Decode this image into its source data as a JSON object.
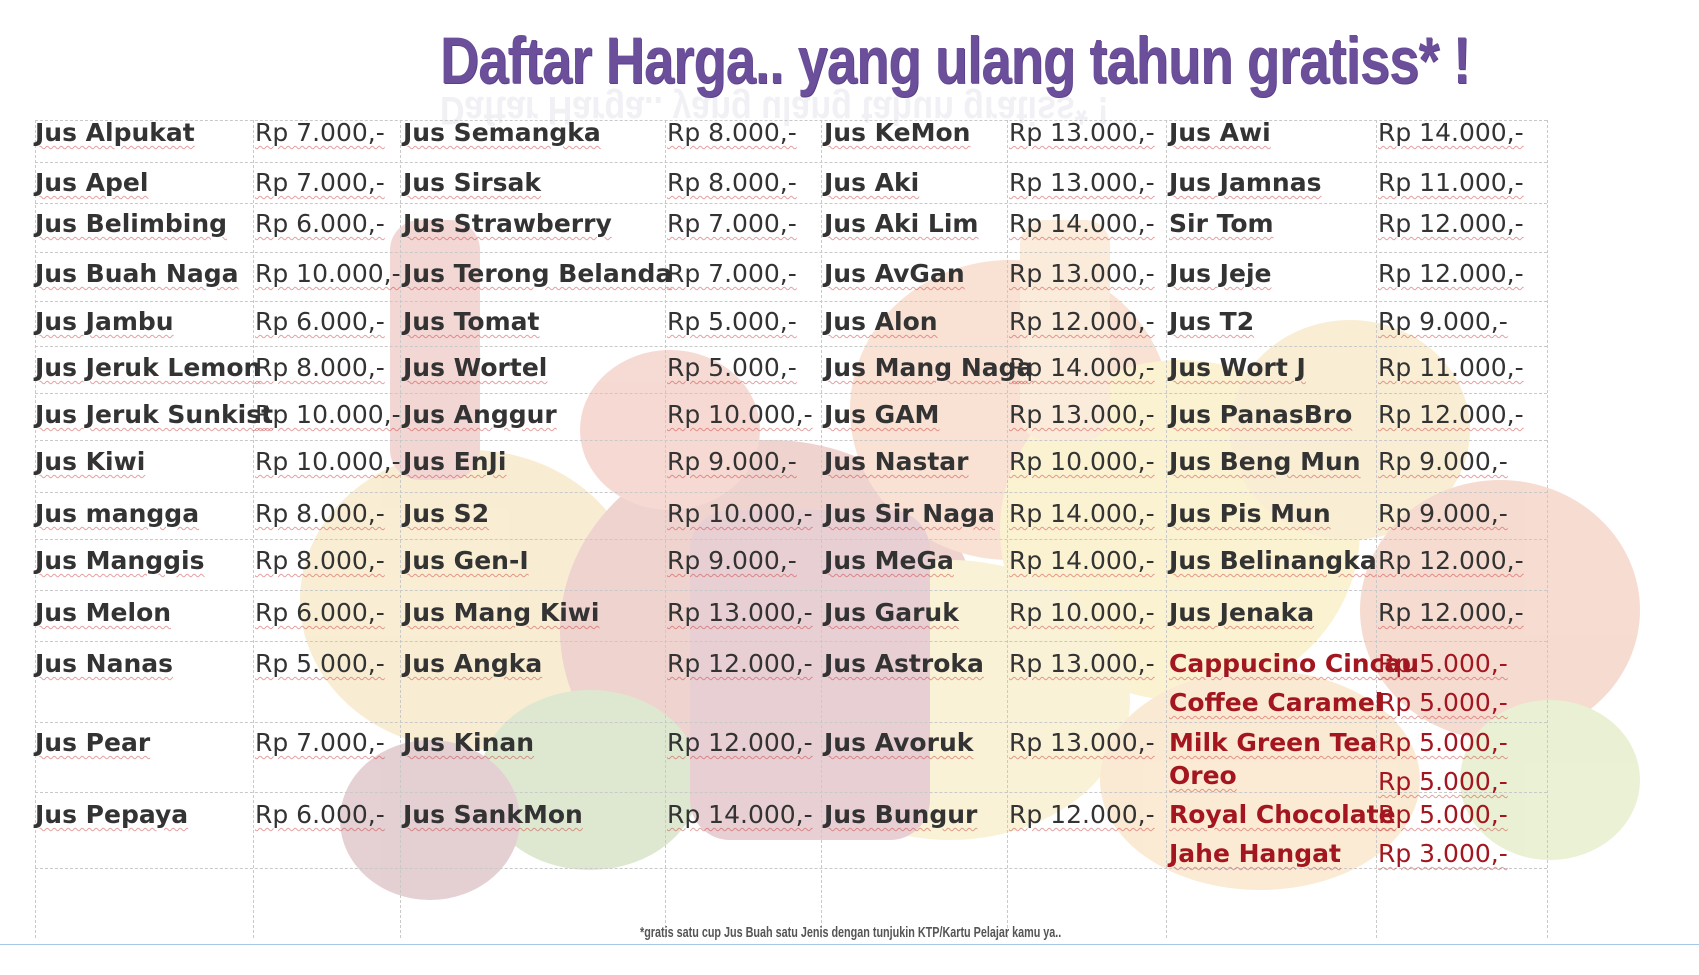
{
  "title": "Daftar Harga.. yang ulang tahun gratiss* !",
  "footnote": "*gratis satu cup Jus Buah satu Jenis dengan tunjukin KTP/Kartu Pelajar kamu ya..",
  "colors": {
    "title": "#6b4f9a",
    "special": "#a3161f",
    "text": "#333333"
  },
  "columns": [
    {
      "items": [
        {
          "name": "Jus Alpukat",
          "price": "Rp  7.000,-"
        },
        {
          "name": "Jus Apel",
          "price": "Rp  7.000,-"
        },
        {
          "name": "Jus Belimbing",
          "price": "Rp  6.000,-"
        },
        {
          "name": "Jus Buah Naga",
          "price": "Rp 10.000,-"
        },
        {
          "name": "Jus Jambu",
          "price": "Rp  6.000,-"
        },
        {
          "name": "Jus Jeruk Lemon",
          "price": "Rp  8.000,-"
        },
        {
          "name": "Jus Jeruk Sunkist",
          "price": "Rp 10.000,-"
        },
        {
          "name": "Jus Kiwi",
          "price": "Rp 10.000,-"
        },
        {
          "name": "Jus mangga",
          "price": "Rp  8.000,-"
        },
        {
          "name": "Jus Manggis",
          "price": "Rp  8.000,-"
        },
        {
          "name": "Jus Melon",
          "price": "Rp  6.000,-"
        },
        {
          "name": "Jus Nanas",
          "price": "Rp  5.000,-"
        },
        {
          "name": "Jus Pear",
          "price": "Rp  7.000,-"
        },
        {
          "name": "Jus Pepaya",
          "price": "Rp  6.000,-"
        }
      ]
    },
    {
      "items": [
        {
          "name": "Jus Semangka",
          "price": "Rp  8.000,-"
        },
        {
          "name": "Jus Sirsak",
          "price": "Rp  8.000,-"
        },
        {
          "name": "Jus Strawberry",
          "price": "Rp  7.000,-"
        },
        {
          "name": "Jus Terong Belanda",
          "price": "Rp  7.000,-"
        },
        {
          "name": "Jus Tomat",
          "price": "Rp  5.000,-"
        },
        {
          "name": "Jus Wortel",
          "price": "Rp  5.000,-"
        },
        {
          "name": "Jus Anggur",
          "price": "Rp 10.000,-"
        },
        {
          "name": "Jus EnJi",
          "price": "Rp  9.000,-"
        },
        {
          "name": "Jus S2",
          "price": "Rp 10.000,-"
        },
        {
          "name": "Jus  Gen-I",
          "price": "Rp  9.000,-"
        },
        {
          "name": "Jus  Mang Kiwi",
          "price": "Rp 13.000,-"
        },
        {
          "name": "Jus  Angka",
          "price": "Rp 12.000,-"
        },
        {
          "name": "Jus Kinan",
          "price": "Rp 12.000,-"
        },
        {
          "name": "Jus  SankMon",
          "price": "Rp 14.000,-"
        }
      ]
    },
    {
      "items": [
        {
          "name": "Jus KeMon",
          "price": "Rp 13.000,-"
        },
        {
          "name": "Jus Aki",
          "price": "Rp 13.000,-"
        },
        {
          "name": "Jus Aki Lim",
          "price": "Rp 14.000,-"
        },
        {
          "name": "Jus AvGan",
          "price": "Rp 13.000,-"
        },
        {
          "name": "Jus Alon",
          "price": "Rp 12.000,-"
        },
        {
          "name": "Jus Mang Naga",
          "price": "Rp 14.000,-"
        },
        {
          "name": "Jus GAM",
          "price": "Rp 13.000,-"
        },
        {
          "name": "Jus Nastar",
          "price": "Rp 10.000,-"
        },
        {
          "name": "Jus Sir Naga",
          "price": "Rp 14.000,-"
        },
        {
          "name": "Jus MeGa",
          "price": "Rp 14.000,-"
        },
        {
          "name": "Jus Garuk",
          "price": "Rp 10.000,-"
        },
        {
          "name": "Jus Astroka",
          "price": "Rp 13.000,-"
        },
        {
          "name": "Jus Avoruk",
          "price": "Rp 13.000,-"
        },
        {
          "name": "Jus Bungur",
          "price": "Rp 12.000,-"
        }
      ]
    },
    {
      "items": [
        {
          "name": "Jus Awi",
          "price": "Rp 14.000,-"
        },
        {
          "name": "Jus Jamnas",
          "price": "Rp 11.000,-"
        },
        {
          "name": "Sir Tom",
          "price": "Rp 12.000,-"
        },
        {
          "name": "Jus Jeje",
          "price": "Rp 12.000,-"
        },
        {
          "name": "Jus T2",
          "price": "Rp  9.000,-"
        },
        {
          "name": "Jus Wort J",
          "price": "Rp 11.000,-"
        },
        {
          "name": "Jus PanasBro",
          "price": "Rp 12.000,-"
        },
        {
          "name": "Jus Beng Mun",
          "price": "Rp  9.000,-"
        },
        {
          "name": "Jus Pis Mun",
          "price": "Rp  9.000,-"
        },
        {
          "name": "Jus Belinangka",
          "price": "Rp 12.000,-"
        },
        {
          "name": "Jus Jenaka",
          "price": "Rp 12.000,-"
        }
      ],
      "specials": [
        {
          "name": "Cappucino Cincau",
          "price": "Rp  5.000,-"
        },
        {
          "name": "Coffee Caramel",
          "price": "Rp  5.000,-"
        },
        {
          "name": "Milk Green Tea",
          "price": "Rp  5.000,-"
        },
        {
          "name": "Oreo",
          "price": "Rp  5.000,-"
        },
        {
          "name": "Royal Chocolate",
          "price": "Rp  5.000,-"
        },
        {
          "name": "Jahe Hangat",
          "price": "Rp  3.000,-"
        }
      ]
    }
  ]
}
